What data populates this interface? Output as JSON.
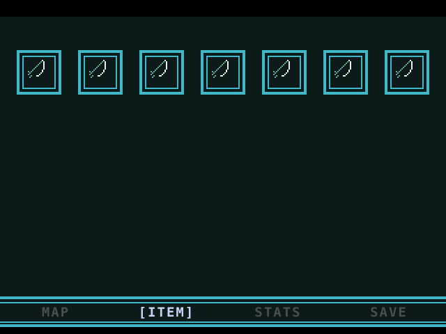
{
  "inventory": {
    "slots": [
      {
        "icon": "bow-icon"
      },
      {
        "icon": "bow-icon"
      },
      {
        "icon": "bow-icon"
      },
      {
        "icon": "bow-icon"
      },
      {
        "icon": "bow-icon"
      },
      {
        "icon": "bow-icon"
      },
      {
        "icon": "bow-icon"
      }
    ]
  },
  "menu": {
    "map_label": "MAP",
    "item_label": "[ITEM]",
    "stats_label": "STATS",
    "save_label": "SAVE",
    "active_tab": "ITEM"
  },
  "colors": {
    "accent": "#3fb7c7",
    "background": "#0d1a1a",
    "menu_inactive": "#4a4e52",
    "menu_active": "#c9d4f5"
  }
}
